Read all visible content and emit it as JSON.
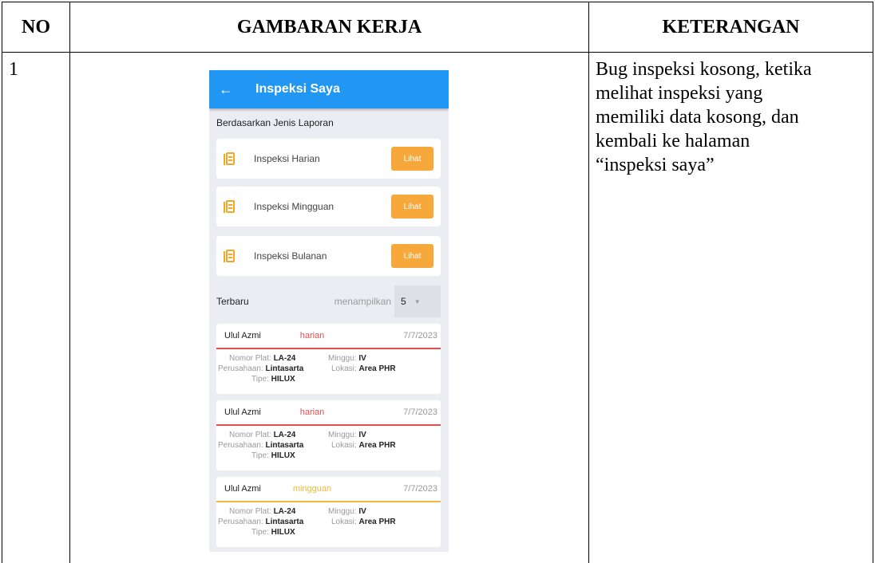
{
  "table": {
    "headers": [
      "NO",
      "GAMBARAN KERJA",
      "KETERANGAN"
    ],
    "row": {
      "no": "1",
      "keterangan_lines": [
        "Bug inspeksi kosong, ketika",
        "melihat inspeksi yang",
        "memiliki data kosong, dan",
        "kembali ke halaman",
        "“inspeksi saya”"
      ]
    }
  },
  "app": {
    "title": "Inspeksi Saya",
    "section_title": "Berdasarkan Jenis Laporan",
    "report_types": [
      {
        "label": "Inspeksi Harian",
        "button": "Lihat"
      },
      {
        "label": "Inspeksi Mingguan",
        "button": "Lihat"
      },
      {
        "label": "Inspeksi Bulanan",
        "button": "Lihat"
      }
    ],
    "latest": {
      "label": "Terbaru",
      "show_label": "menampilkan",
      "count": "5"
    },
    "inspections": [
      {
        "name": "Ulul Azmi",
        "type": "harian",
        "type_color": "#e05050",
        "date": "7/7/2023",
        "plate_label": "Nomor Plat:",
        "plate": "LA-24",
        "week_label": "Minggu:",
        "week": "IV",
        "company_label": "Perusahaan:",
        "company": "Lintasarta",
        "location_label": "Lokasi:",
        "location": "Area PHR",
        "vehicle_label": "Tipe:",
        "vehicle": "HILUX"
      },
      {
        "name": "Ulul Azmi",
        "type": "harian",
        "type_color": "#e05050",
        "date": "7/7/2023",
        "plate_label": "Nomor Plat:",
        "plate": "LA-24",
        "week_label": "Minggu:",
        "week": "IV",
        "company_label": "Perusahaan:",
        "company": "Lintasarta",
        "location_label": "Lokasi:",
        "location": "Area PHR",
        "vehicle_label": "Tipe:",
        "vehicle": "HILUX"
      },
      {
        "name": "Ulul Azmi",
        "type": "mingguan",
        "type_color": "#f5b73b",
        "date": "7/7/2023",
        "plate_label": "Nomor Plat:",
        "plate": "LA-24",
        "week_label": "Minggu:",
        "week": "IV",
        "company_label": "Perusahaan:",
        "company": "Lintasarta",
        "location_label": "Lokasi:",
        "location": "Area PHR",
        "vehicle_label": "Tipe:",
        "vehicle": "HILUX"
      }
    ],
    "colors": {
      "appbar": "#2196f3",
      "accent": "#f6a83b"
    }
  }
}
